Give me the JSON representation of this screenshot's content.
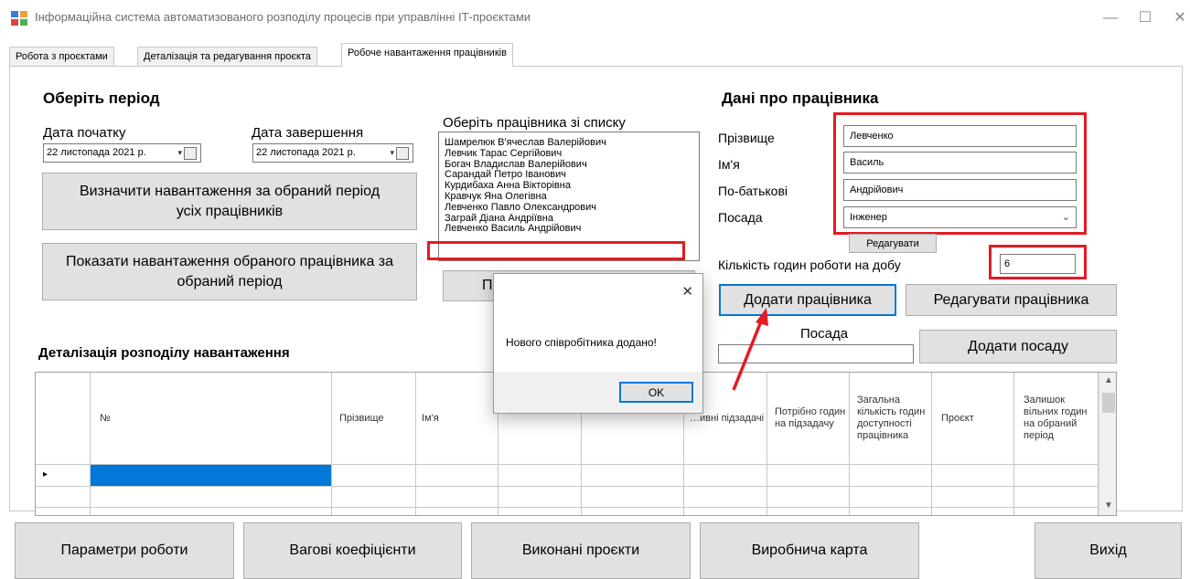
{
  "window": {
    "title": "Інформаційна система автоматизованого розподілу процесів при управлінні ІТ-проєктами",
    "minimize_glyph": "—",
    "maximize_glyph": "☐",
    "close_glyph": "✕"
  },
  "tabs": [
    {
      "label": "Робота з проєктами",
      "active": false
    },
    {
      "label": "Деталізація та редагування проєкта",
      "active": false
    },
    {
      "label": "Робоче навантаження працівників",
      "active": true
    }
  ],
  "period": {
    "heading": "Оберіть період",
    "start_label": "Дата початку",
    "start_value": "22 листопада 2021 р.",
    "end_label": "Дата завершення",
    "end_value": "22 листопада 2021 р."
  },
  "actions": {
    "all_load_button": "Визначити навантаження за обраний період усіх працівників",
    "selected_load_button": "Показати навантаження обраного працівника за обраний період",
    "hidden_button_fragment": "П"
  },
  "employee_list": {
    "label": "Оберіть працівника зі списку",
    "items": [
      "Шамрелюк В'ячеслав Валерійович",
      "Левчик Тарас Сергійович",
      "Богач Владислав Валерійович",
      "Сарандай Петро Іванович",
      "Курдибаха Анна Вікторівна",
      "Кравчук Яна Олегівна",
      "Левченко Павло Олександрович",
      "Заграй Діана Андріївна",
      "Левченко Василь Андрійович"
    ]
  },
  "employee": {
    "heading": "Дані про працівника",
    "surname_label": "Прізвище",
    "surname_value": "Левченко",
    "name_label": "Ім'я",
    "name_value": "Василь",
    "patronymic_label": "По-батькові",
    "patronymic_value": "Андрійович",
    "position_label": "Посада",
    "position_value": "Інженер",
    "edit_small_button": "Редагувати",
    "hours_label": "Кількість годин роботи на добу",
    "hours_value": "6",
    "add_button": "Додати працівника",
    "edit_button": "Редагувати працівника",
    "new_position_label": "Посада",
    "new_position_value": "",
    "add_position_button": "Додати посаду"
  },
  "grid": {
    "title": "Деталізація розподілу навантаження",
    "columns": [
      "№",
      "Прізвище",
      "Ім'я",
      "",
      "",
      "…ивні підзадачі",
      "Потрібно годин на підзадачу",
      "Загальна кількість годин доступності працівника",
      "Проєкт",
      "Залишок вільних годин на обраний період"
    ],
    "row_marker": "▸"
  },
  "dialog": {
    "message": "Нового співробітника додано!",
    "ok_label": "OK",
    "close_glyph": "✕"
  },
  "bottom_buttons": [
    "Параметри роботи",
    "Вагові коефіцієнти",
    "Виконані проєкти",
    "Виробнича карта",
    "Вихід"
  ],
  "colors": {
    "highlight_red": "#e31b23",
    "selection_blue": "#0078d7",
    "button_gray": "#e1e1e1"
  }
}
